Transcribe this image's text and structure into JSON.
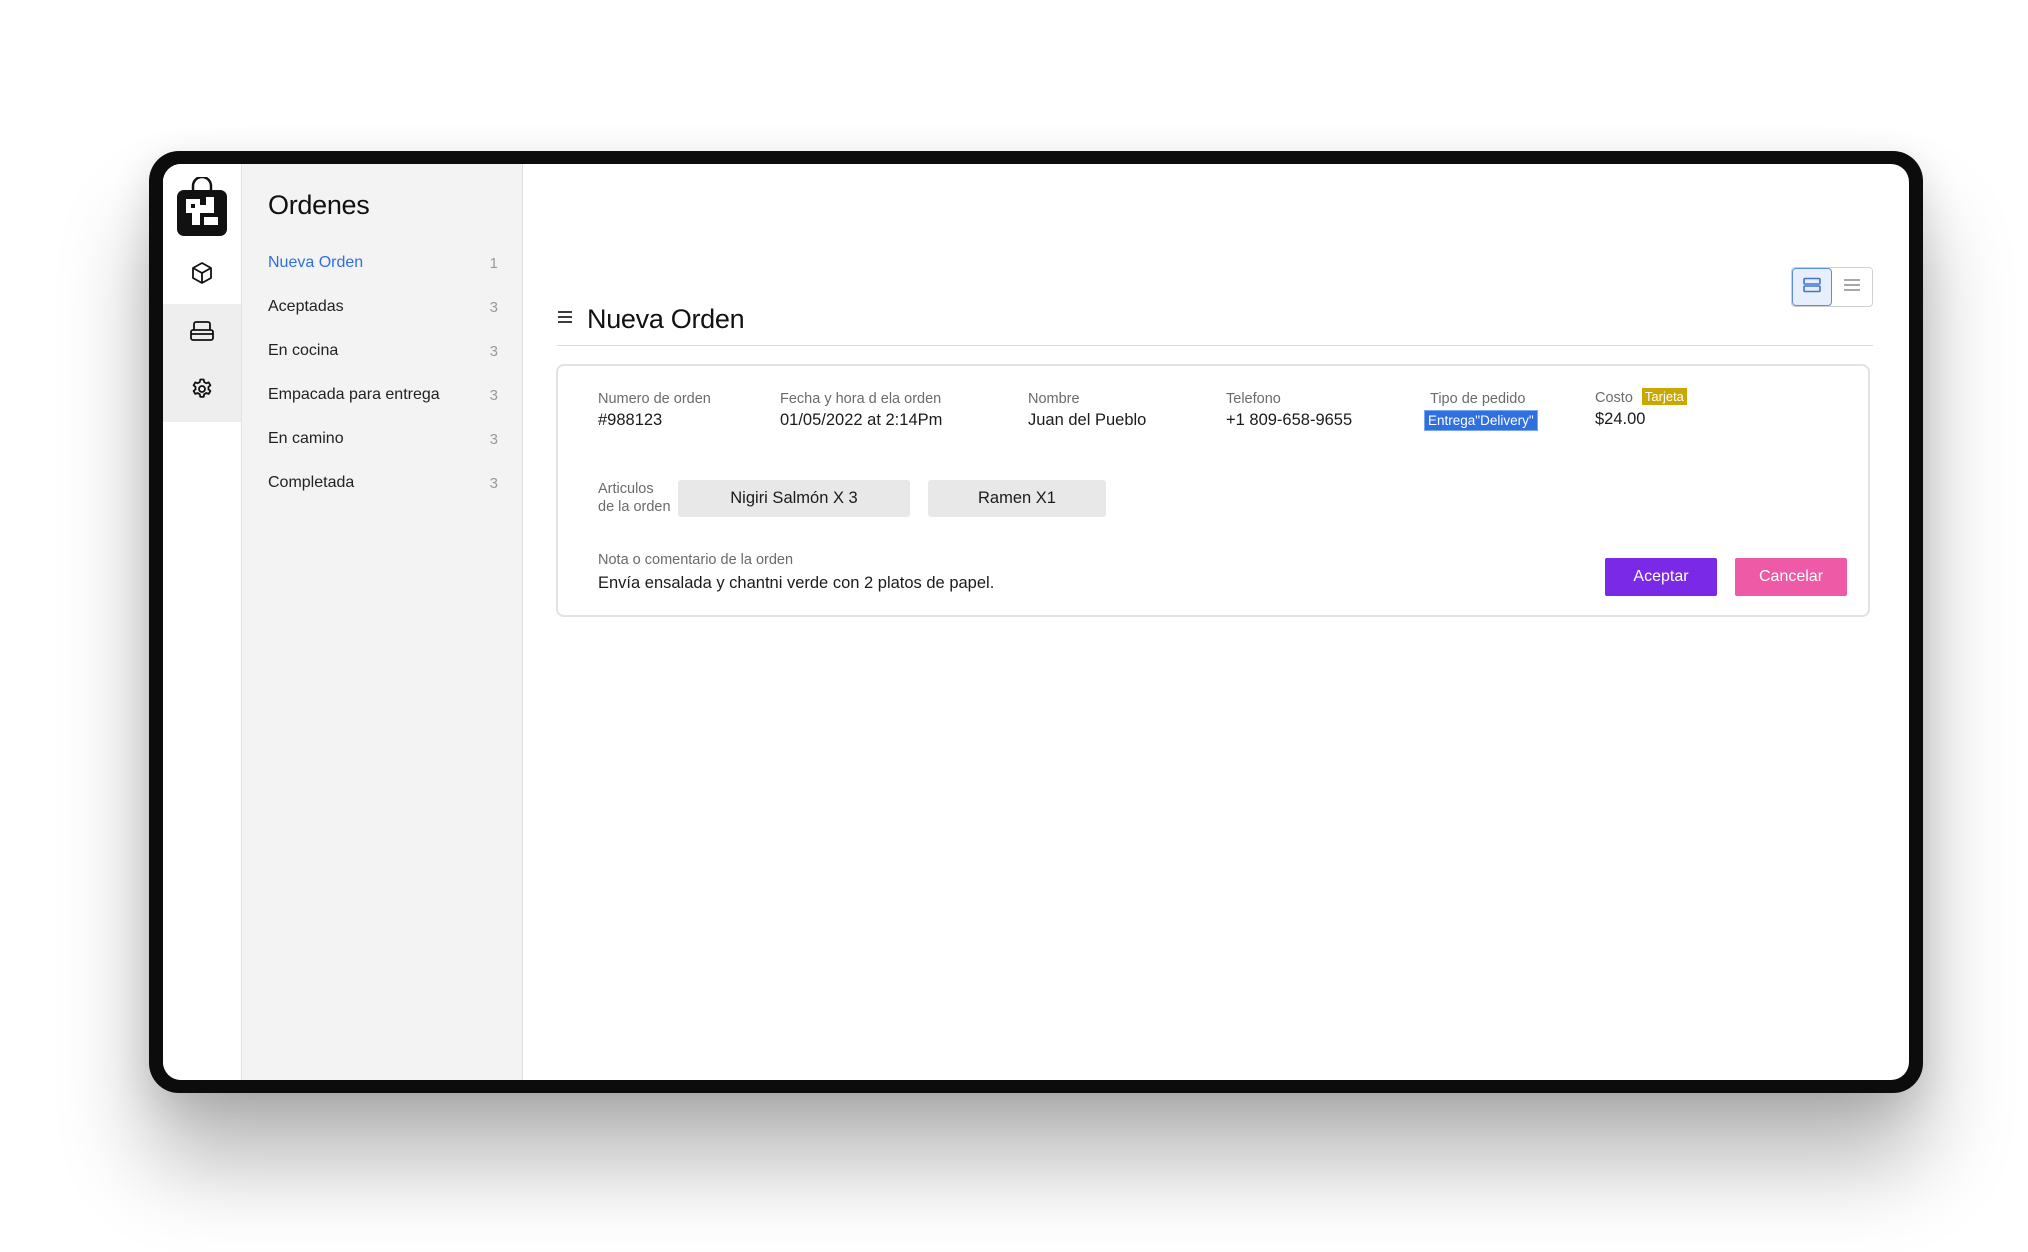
{
  "sidebar": {
    "title": "Ordenes",
    "items": [
      {
        "label": "Nueva Orden",
        "count": "1"
      },
      {
        "label": "Aceptadas",
        "count": "3"
      },
      {
        "label": "En cocina",
        "count": "3"
      },
      {
        "label": "Empacada para entrega",
        "count": "3"
      },
      {
        "label": "En camino",
        "count": "3"
      },
      {
        "label": "Completada",
        "count": "3"
      }
    ]
  },
  "rail": {
    "icons": [
      "logo-bag-icon",
      "box-icon",
      "tray-icon",
      "gear-icon"
    ]
  },
  "main": {
    "title": "Nueva Orden",
    "view_modes": [
      "card-view-icon",
      "list-view-icon"
    ]
  },
  "order": {
    "number_label": "Numero de orden",
    "number": "#988123",
    "datetime_label": "Fecha y hora d ela orden",
    "datetime": "01/05/2022 at 2:14Pm",
    "name_label": "Nombre",
    "name": "Juan del Pueblo",
    "phone_label": "Telefono",
    "phone": "+1 809-658-9655",
    "type_label": "Tipo de pedido",
    "type": "Entrega\"Delivery\"",
    "cost_label": "Costo",
    "payment": "Tarjeta",
    "cost": "$24.00",
    "items_label_line1": "Articulos",
    "items_label_line2": "de la orden",
    "items": [
      "Nigiri Salmón   X 3",
      "Ramen X1"
    ],
    "note_label": "Nota o comentario de la orden",
    "note": "Envía ensalada y chantni verde con 2 platos de papel.",
    "accept_label": "Aceptar",
    "cancel_label": "Cancelar"
  },
  "colors": {
    "accent_blue": "#2f6fe0",
    "accept": "#7a2ae6",
    "cancel": "#ee5aa6",
    "payment_badge": "#c9a800"
  }
}
